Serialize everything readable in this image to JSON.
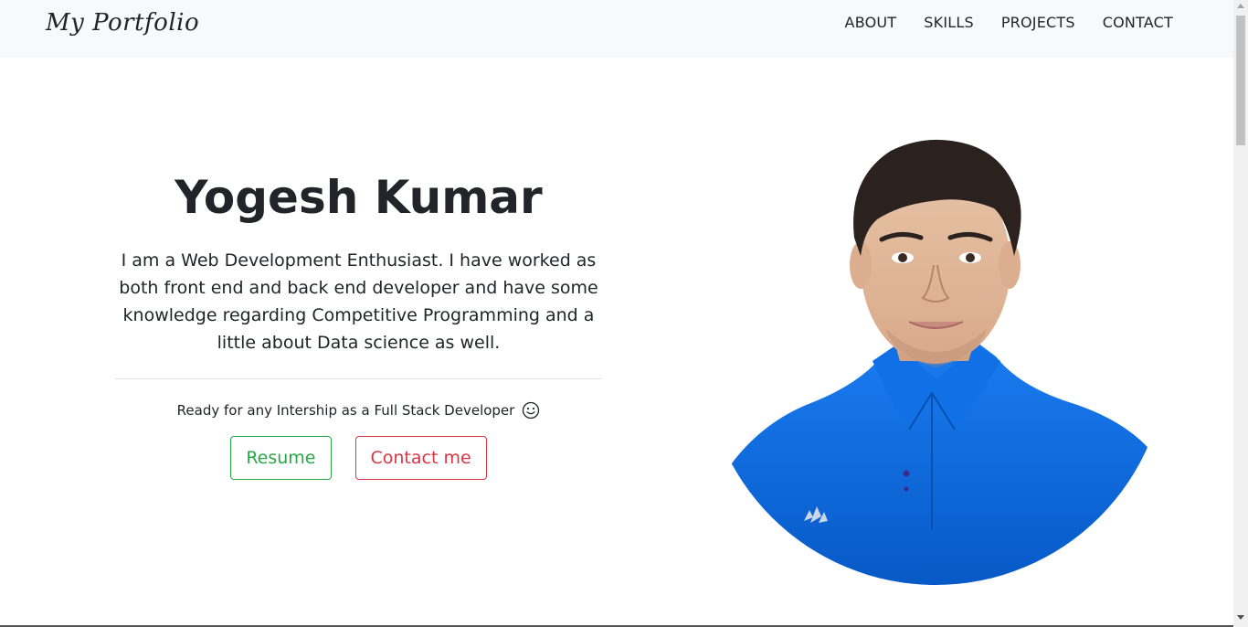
{
  "nav": {
    "brand": "My Portfolio",
    "links": [
      "ABOUT",
      "SKILLS",
      "PROJECTS",
      "CONTACT"
    ]
  },
  "hero": {
    "name": "Yogesh Kumar",
    "description": "I am a Web Development Enthusiast. I have worked as both front end and back end developer and have some knowledge regarding Competitive Programming and a little about Data science as well.",
    "tagline": "Ready for any Intership as a Full Stack Developer",
    "resume_button": "Resume",
    "contact_button": "Contact me",
    "tagline_icon": "smile-icon"
  },
  "portrait": {
    "shirt_logo": "adidas"
  },
  "colors": {
    "navbar_bg": "#f8f9fa",
    "resume_accent": "#28a745",
    "contact_accent": "#dc3545",
    "shirt_blue": "#0a6ee0"
  }
}
